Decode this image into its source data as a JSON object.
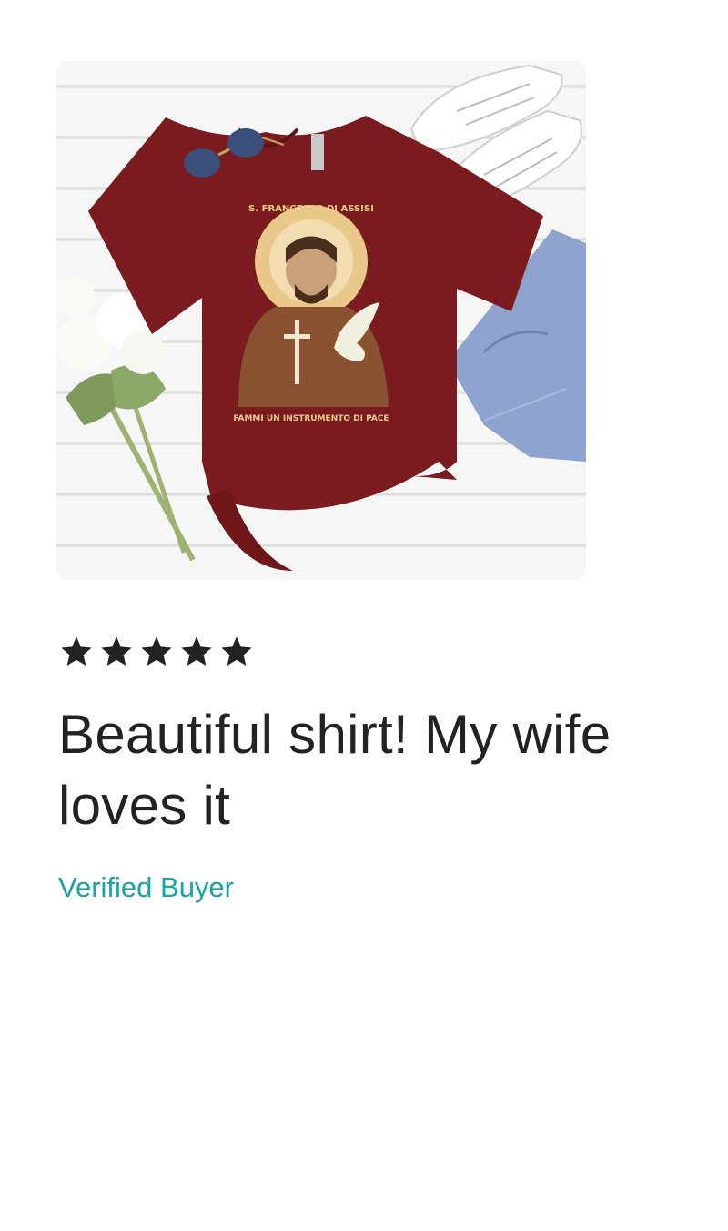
{
  "review": {
    "product_image": {
      "shirt_text_top": "S. FRANCESCO DI ASSISI",
      "shirt_text_bottom": "FAMMI UN INSTRUMENTO DI PACE",
      "shirt_color": "#7a1c1f"
    },
    "rating": 5,
    "rating_max": 5,
    "text": "Beautiful shirt!  My wife loves it",
    "verified_label": "Verified Buyer",
    "colors": {
      "text": "#222222",
      "accent": "#14a6a6"
    }
  }
}
